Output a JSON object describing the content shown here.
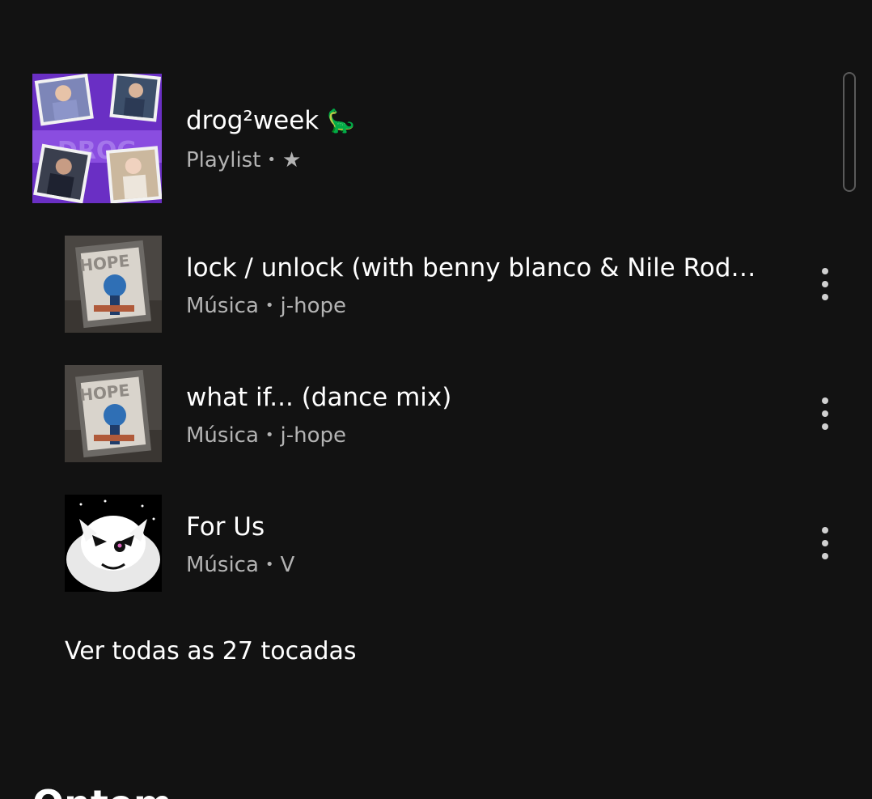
{
  "playlist": {
    "title": "drog²week",
    "emoji": "🦕",
    "type": "Playlist",
    "separator": "•",
    "star": "★"
  },
  "tracks": [
    {
      "title": "lock / unlock (with benny blanco & Nile Rodgers)",
      "type": "Música",
      "separator": "•",
      "artist": "j-hope",
      "menu_icon": "more-vertical-icon"
    },
    {
      "title": "what if... (dance mix)",
      "type": "Música",
      "separator": "•",
      "artist": "j-hope",
      "menu_icon": "more-vertical-icon"
    },
    {
      "title": "For Us",
      "type": "Música",
      "separator": "•",
      "artist": "V",
      "menu_icon": "more-vertical-icon"
    }
  ],
  "see_all": "Ver todas as 27 tocadas",
  "next_section": "Ontem",
  "colors": {
    "background": "#121212",
    "primary_text": "#ffffff",
    "secondary_text": "#b3b3b3",
    "playlist_art": "#6a2fc4"
  }
}
